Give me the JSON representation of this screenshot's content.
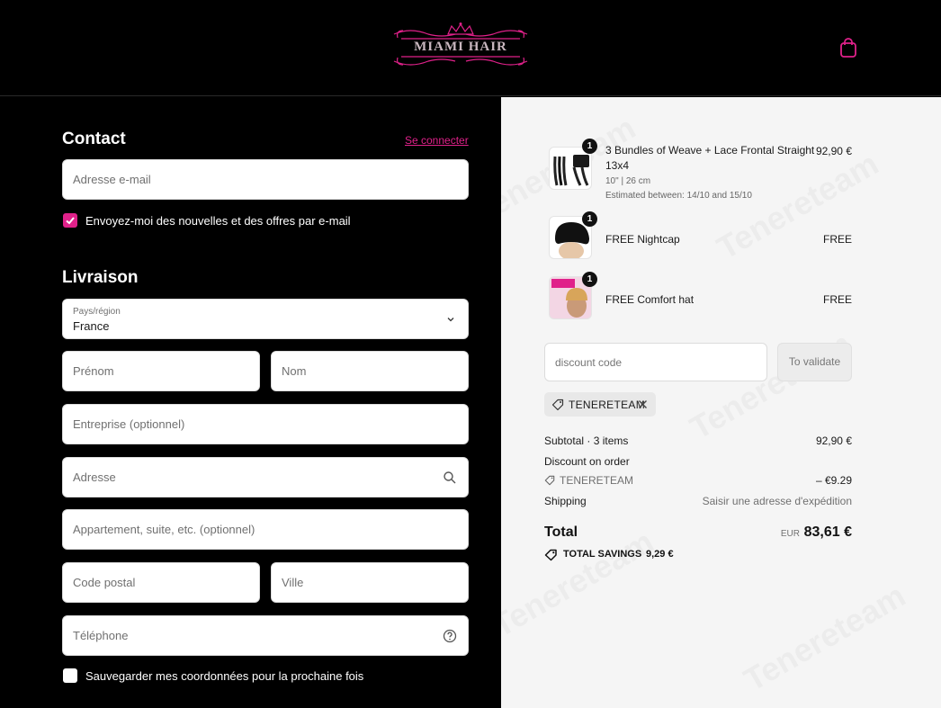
{
  "header": {
    "logo_text": "MIAMI HAIR"
  },
  "contact": {
    "title": "Contact",
    "login_link": "Se connecter",
    "email_placeholder": "Adresse e-mail",
    "newsletter_label": "Envoyez-moi des nouvelles et des offres par e-mail",
    "newsletter_checked": true
  },
  "shipping": {
    "title": "Livraison",
    "country_label": "Pays/région",
    "country_value": "France",
    "first_name_placeholder": "Prénom",
    "last_name_placeholder": "Nom",
    "company_placeholder": "Entreprise (optionnel)",
    "address_placeholder": "Adresse",
    "apartment_placeholder": "Appartement, suite, etc. (optionnel)",
    "postal_placeholder": "Code postal",
    "city_placeholder": "Ville",
    "phone_placeholder": "Téléphone",
    "save_info_label": "Sauvegarder mes coordonnées pour la prochaine fois",
    "save_info_checked": false
  },
  "summary": {
    "items": [
      {
        "name_line1": "3 Bundles of Weave + Lace Frontal Straight",
        "name_line2": "13x4",
        "variant": "10\" | 26 cm",
        "eta": "Estimated between: 14/10 and 15/10",
        "price": "92,90 €",
        "qty": "1"
      },
      {
        "name_line1": "FREE Nightcap",
        "price": "FREE",
        "qty": "1"
      },
      {
        "name_line1": "FREE Comfort hat",
        "price": "FREE",
        "qty": "1"
      }
    ],
    "discount_placeholder": "discount code",
    "validate_label": "To validate",
    "applied_code": "TENERETEAM",
    "subtotal_label": "Subtotal · 3 items",
    "subtotal_value": "92,90 €",
    "discount_label": "Discount on order",
    "discount_code": "TENERETEAM",
    "discount_value": "– €9.29",
    "shipping_label": "Shipping",
    "shipping_value": "Saisir une adresse d'expédition",
    "total_label": "Total",
    "currency": "EUR",
    "total_value": "83,61 €",
    "savings_label": "TOTAL SAVINGS",
    "savings_value": "9,29 €"
  },
  "colors": {
    "accent": "#e0218a",
    "background_dark": "#000000",
    "summary_bg": "#f5f5f5"
  },
  "icons": [
    "crown-logo-icon",
    "shopping-bag-icon",
    "chevron-down-icon",
    "search-icon",
    "help-circle-icon",
    "tag-icon",
    "close-icon",
    "check-icon"
  ]
}
